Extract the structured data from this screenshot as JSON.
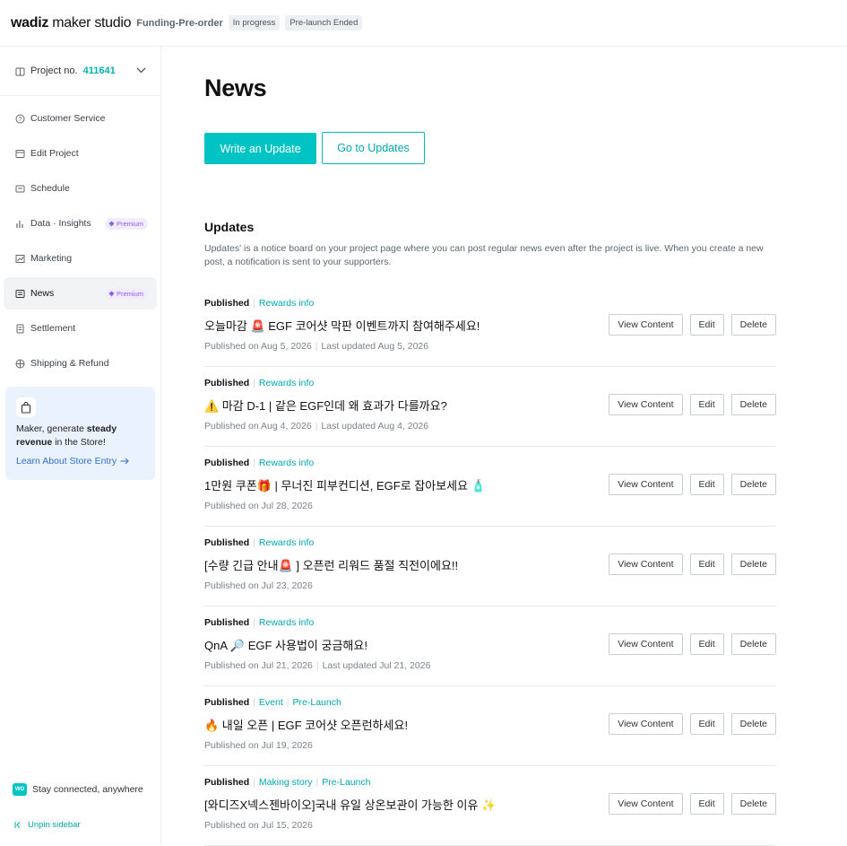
{
  "header": {
    "brand_bold": "wadiz",
    "brand_rest": " maker studio",
    "project_type": "Funding-Pre-order",
    "badges": [
      "In progress",
      "Pre-launch Ended"
    ]
  },
  "sidebar": {
    "project_label": "Project no.",
    "project_no": "411641",
    "items": [
      {
        "label": "Customer Service",
        "icon": "question-circle-icon"
      },
      {
        "label": "Edit Project",
        "icon": "edit-project-icon"
      },
      {
        "label": "Schedule",
        "icon": "schedule-icon"
      },
      {
        "label": "Data · Insights",
        "icon": "bar-chart-icon",
        "premium": "Premium"
      },
      {
        "label": "Marketing",
        "icon": "marketing-chart-icon"
      },
      {
        "label": "News",
        "icon": "news-icon",
        "premium": "Premium",
        "active": true
      },
      {
        "label": "Settlement",
        "icon": "settlement-icon"
      },
      {
        "label": "Shipping & Refund",
        "icon": "shipping-icon"
      }
    ],
    "promo": {
      "line1_prefix": "Maker, generate ",
      "line1_bold": "steady",
      "line2_bold": "revenue",
      "line2_suffix": " in the Store!",
      "link": "Learn About Store Entry"
    },
    "stay_connected": "Stay connected, anywhere",
    "wo_logo": "WO",
    "unpin": "Unpin sidebar"
  },
  "main": {
    "title": "News",
    "write_button": "Write an Update",
    "goto_button": "Go to Updates",
    "section_title": "Updates",
    "section_desc": "Updates' is a notice board on your project page where you can post regular news even after the project is live. When you create a new post, a notification is sent to your supporters.",
    "actions": {
      "view": "View Content",
      "edit": "Edit",
      "delete": "Delete"
    },
    "updates": [
      {
        "status": "Published",
        "tags": [
          "Rewards info"
        ],
        "title": "오늘마감 🚨 EGF 코어샷 막판 이벤트까지 참여해주세요!",
        "published": "Published on Aug 5, 2026",
        "updated": "Last updated Aug 5, 2026"
      },
      {
        "status": "Published",
        "tags": [
          "Rewards info"
        ],
        "title": "⚠️ 마감 D-1 | 같은 EGF인데 왜 효과가 다를까요?",
        "published": "Published on Aug 4, 2026",
        "updated": "Last updated Aug 4, 2026"
      },
      {
        "status": "Published",
        "tags": [
          "Rewards info"
        ],
        "title": "1만원 쿠폰🎁 | 무너진 피부컨디션, EGF로 잡아보세요 🧴",
        "published": "Published on Jul 28, 2026",
        "updated": ""
      },
      {
        "status": "Published",
        "tags": [
          "Rewards info"
        ],
        "title": "[수량 긴급 안내🚨 ] 오픈런 리워드 품절 직전이에요!!",
        "published": "Published on Jul 23, 2026",
        "updated": ""
      },
      {
        "status": "Published",
        "tags": [
          "Rewards info"
        ],
        "title": "QnA 🔎 EGF 사용법이 궁금해요!",
        "published": "Published on Jul 21, 2026",
        "updated": "Last updated Jul 21, 2026"
      },
      {
        "status": "Published",
        "tags": [
          "Event",
          "Pre-Launch"
        ],
        "title": "🔥 내일 오픈 | EGF 코어샷 오픈런하세요!",
        "published": "Published on Jul 19, 2026",
        "updated": ""
      },
      {
        "status": "Published",
        "tags": [
          "Making story",
          "Pre-Launch"
        ],
        "title": "[와디즈X넥스젠바이오]국내 유일 상온보관이 가능한 이유 ✨",
        "published": "Published on Jul 15, 2026",
        "updated": ""
      }
    ]
  },
  "colors": {
    "accent": "#00c4c4",
    "premium": "#8a5cf6",
    "link_blue": "#2f6fd1"
  }
}
